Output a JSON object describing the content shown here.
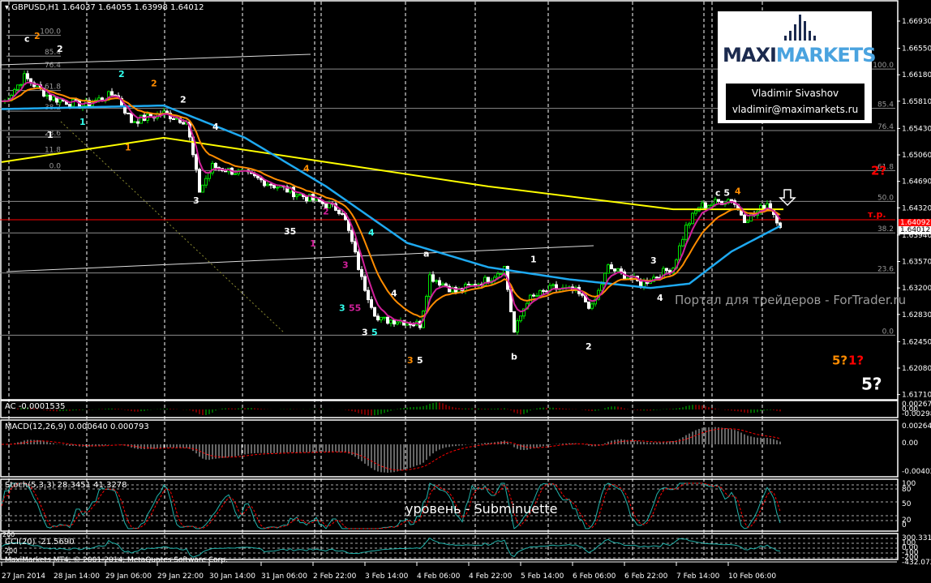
{
  "header": {
    "symbol": "GBPUSD,H1",
    "ohlc": "1.64037 1.64055 1.63998 1.64012"
  },
  "indicators": {
    "ac": "AC -0.0001535",
    "macd": "MACD(12,26,9) 0.000640 0.000793",
    "stoch": "Stoch(5,3,3) 28.3451 41.3278",
    "cci": "CCI(20) -21.5690",
    "copyright": "MaxiMarkets MT4, © 2001-2014, MetaQuotes Software Corp."
  },
  "scales": {
    "ac": [
      "0.002676",
      "0.00",
      "-0.002980"
    ],
    "macd": [
      "0.002644",
      "0.00",
      "-0.004028"
    ],
    "stoch": [
      "100",
      "80",
      "50",
      "20",
      "0"
    ],
    "cci": [
      "300.3311",
      "100",
      "0.00",
      "-100",
      "-200",
      "-432.0724"
    ],
    "cci_left": [
      "200",
      "-200"
    ]
  },
  "logo": {
    "brand_a": "MAXI",
    "brand_b": "MARKETS",
    "author": "Vladimir Sivashov",
    "email": "vladimir@maximarkets.ru"
  },
  "watermark": "Портал для трейдеров - ForTrader.ru",
  "caption": "уровень - Subminuette",
  "bid": "1.64092",
  "last": "1.64012",
  "colors": {
    "bull": "#00e000",
    "bear": "#ffffff",
    "ma200": "#ffff00",
    "ma_blue": "#1ea9f0",
    "ma_orange": "#ff8c00",
    "ma_magenta": "#d0209a",
    "fib": "#8c8c8c",
    "red": "#ff0000"
  },
  "chart_data": {
    "type": "candlestick",
    "title": "GBPUSD,H1",
    "ylim": [
      1.6155,
      1.6725
    ],
    "y_ticks": [
      "1.66930",
      "1.66550",
      "1.66180",
      "1.65810",
      "1.65430",
      "1.65060",
      "1.64690",
      "1.64320",
      "1.63940",
      "1.63570",
      "1.63200",
      "1.62830",
      "1.62450",
      "1.62080",
      "1.61710"
    ],
    "x_ticks": [
      "27 Jan 2014",
      "28 Jan 14:00",
      "29 Jan 06:00",
      "29 Jan 22:00",
      "30 Jan 14:00",
      "31 Jan 06:00",
      "2 Feb 22:00",
      "3 Feb 14:00",
      "4 Feb 06:00",
      "4 Feb 22:00",
      "5 Feb 14:00",
      "6 Feb 06:00",
      "6 Feb 22:00",
      "7 Feb 14:00",
      "10 Feb 06:00"
    ],
    "price_path": [
      [
        1,
        1.6581
      ],
      [
        7,
        1.6615
      ],
      [
        15,
        1.6586
      ],
      [
        25,
        1.6575
      ],
      [
        35,
        1.6592
      ],
      [
        40,
        1.6553
      ],
      [
        50,
        1.6564
      ],
      [
        57,
        1.6553
      ],
      [
        61,
        1.6456
      ],
      [
        65,
        1.649
      ],
      [
        75,
        1.6479
      ],
      [
        85,
        1.6462
      ],
      [
        95,
        1.6445
      ],
      [
        105,
        1.6428
      ],
      [
        108,
        1.6383
      ],
      [
        111,
        1.6332
      ],
      [
        116,
        1.6275
      ],
      [
        122,
        1.6275
      ],
      [
        129,
        1.6269
      ],
      [
        132,
        1.6337
      ],
      [
        140,
        1.6315
      ],
      [
        150,
        1.6332
      ],
      [
        155,
        1.6349
      ],
      [
        158,
        1.6258
      ],
      [
        162,
        1.6303
      ],
      [
        170,
        1.632
      ],
      [
        177,
        1.6315
      ],
      [
        182,
        1.6292
      ],
      [
        187,
        1.6349
      ],
      [
        197,
        1.6326
      ],
      [
        202,
        1.6337
      ],
      [
        207,
        1.6349
      ],
      [
        211,
        1.6405
      ],
      [
        215,
        1.6434
      ],
      [
        220,
        1.6439
      ],
      [
        225,
        1.6445
      ],
      [
        229,
        1.6417
      ],
      [
        232,
        1.6422
      ],
      [
        236,
        1.6439
      ],
      [
        240,
        1.6409
      ]
    ],
    "ma_yellow": [
      [
        0,
        1.6496
      ],
      [
        50,
        1.653
      ],
      [
        100,
        1.6496
      ],
      [
        150,
        1.6462
      ],
      [
        207,
        1.643
      ],
      [
        241,
        1.643
      ]
    ],
    "ma_blue": [
      [
        0,
        1.657
      ],
      [
        50,
        1.6575
      ],
      [
        75,
        1.653
      ],
      [
        100,
        1.6462
      ],
      [
        125,
        1.6383
      ],
      [
        150,
        1.6349
      ],
      [
        175,
        1.6332
      ],
      [
        200,
        1.632
      ],
      [
        212,
        1.6326
      ],
      [
        225,
        1.6371
      ],
      [
        241,
        1.6409
      ]
    ],
    "fib_left": [
      {
        "label": "100.0",
        "price": 1.6673
      },
      {
        "label": "85.4",
        "price": 1.6644
      },
      {
        "label": "76.4",
        "price": 1.6626
      },
      {
        "label": "61.8",
        "price": 1.6596
      },
      {
        "label": "38.2",
        "price": 1.6567
      },
      {
        "label": "23.6",
        "price": 1.6531
      },
      {
        "label": "11.8",
        "price": 1.6508
      },
      {
        "label": "0.0",
        "price": 1.6485
      }
    ],
    "fib_right": [
      {
        "label": "100.0",
        "price": 1.6626
      },
      {
        "label": "85.4",
        "price": 1.6571
      },
      {
        "label": "76.4",
        "price": 1.654
      },
      {
        "label": "61.8",
        "price": 1.6484
      },
      {
        "label": "50.0",
        "price": 1.6441
      },
      {
        "label": "38.2",
        "price": 1.6397
      },
      {
        "label": "23.6",
        "price": 1.6341
      },
      {
        "label": "0.0",
        "price": 1.6254
      }
    ],
    "annotations": [
      {
        "t": "c",
        "c": "#ffffff",
        "bar": 7,
        "price": 1.6664
      },
      {
        "t": "2",
        "c": "#ff8c00",
        "bar": 10,
        "price": 1.6668
      },
      {
        "t": "2",
        "c": "#ffffff",
        "bar": 17,
        "price": 1.665
      },
      {
        "t": "2",
        "c": "#33ffee",
        "bar": 36,
        "price": 1.6615
      },
      {
        "t": "2",
        "c": "#ff8c00",
        "bar": 46,
        "price": 1.6602
      },
      {
        "t": "2",
        "c": "#ffffff",
        "bar": 55,
        "price": 1.6579
      },
      {
        "t": "1",
        "c": "#33ffee",
        "bar": 24,
        "price": 1.6548
      },
      {
        "t": "1",
        "c": "#ffffff",
        "bar": 14,
        "price": 1.653
      },
      {
        "t": "1",
        "c": "#ff8c00",
        "bar": 38,
        "price": 1.6512
      },
      {
        "t": "4",
        "c": "#ffffff",
        "bar": 65,
        "price": 1.6541
      },
      {
        "t": "4",
        "c": "#ff8c00",
        "bar": 93,
        "price": 1.6483
      },
      {
        "t": "3",
        "c": "#ffffff",
        "bar": 59,
        "price": 1.6438
      },
      {
        "t": "35",
        "c": "#ffffff",
        "bar": 87,
        "price": 1.6395
      },
      {
        "t": "1",
        "c": "#d0209a",
        "bar": 95,
        "price": 1.6378
      },
      {
        "t": "2",
        "c": "#d0209a",
        "bar": 99,
        "price": 1.6423
      },
      {
        "t": "3",
        "c": "#d0209a",
        "bar": 105,
        "price": 1.6348
      },
      {
        "t": "4",
        "c": "#33ffee",
        "bar": 113,
        "price": 1.6393
      },
      {
        "t": "3",
        "c": "#33ffee",
        "bar": 104,
        "price": 1.6288
      },
      {
        "t": "55",
        "c": "#d0209a",
        "bar": 107,
        "price": 1.6288
      },
      {
        "t": "4",
        "c": "#ffffff",
        "bar": 120,
        "price": 1.6308
      },
      {
        "t": "3",
        "c": "#ffffff",
        "bar": 111,
        "price": 1.6254
      },
      {
        "t": "5",
        "c": "#33ffee",
        "bar": 114,
        "price": 1.6254
      },
      {
        "t": "a",
        "c": "#ffffff",
        "bar": 130,
        "price": 1.6364
      },
      {
        "t": "3",
        "c": "#ff8c00",
        "bar": 125,
        "price": 1.6215
      },
      {
        "t": "5",
        "c": "#ffffff",
        "bar": 128,
        "price": 1.6215
      },
      {
        "t": "b",
        "c": "#ffffff",
        "bar": 157,
        "price": 1.622
      },
      {
        "t": "1",
        "c": "#ffffff",
        "bar": 163,
        "price": 1.6356
      },
      {
        "t": "2",
        "c": "#ffffff",
        "bar": 180,
        "price": 1.6234
      },
      {
        "t": "3",
        "c": "#ffffff",
        "bar": 200,
        "price": 1.6354
      },
      {
        "t": "4",
        "c": "#ffffff",
        "bar": 202,
        "price": 1.6302
      },
      {
        "t": "c 5",
        "c": "#ffffff",
        "bar": 220,
        "price": 1.6449
      },
      {
        "t": "4",
        "c": "#ff8c00",
        "bar": 226,
        "price": 1.6451
      },
      {
        "t": "2?",
        "c": "#ff0000",
        "bar": 268,
        "price": 1.6478,
        "big": 1
      },
      {
        "t": "т.р.",
        "c": "#ff0000",
        "bar": 267,
        "price": 1.6419
      },
      {
        "t": "5?",
        "c": "#ff8c00",
        "bar": 256,
        "price": 1.6213,
        "big": 1
      },
      {
        "t": "1?",
        "c": "#ff0000",
        "bar": 261,
        "price": 1.6213,
        "big": 1
      },
      {
        "t": "5?",
        "c": "#ffffff",
        "bar": 265,
        "price": 1.6178,
        "big": 2
      }
    ]
  }
}
